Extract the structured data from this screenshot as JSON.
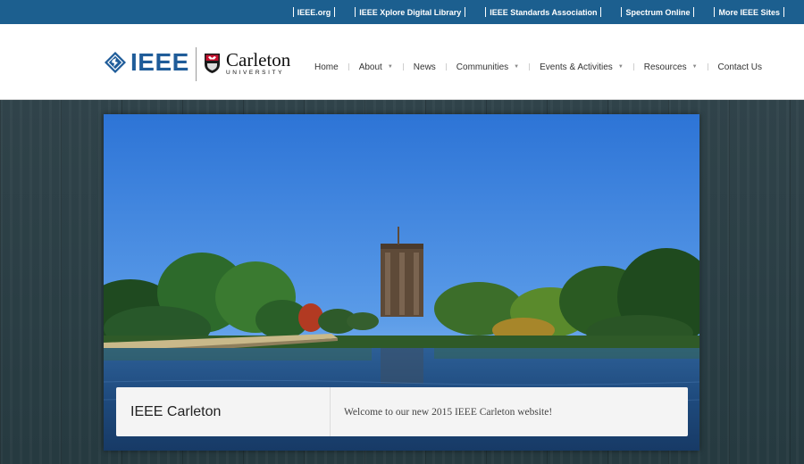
{
  "top_links": [
    {
      "label": "IEEE.org"
    },
    {
      "label": "IEEE Xplore Digital Library"
    },
    {
      "label": "IEEE Standards Association"
    },
    {
      "label": "Spectrum Online"
    },
    {
      "label": "More IEEE Sites"
    }
  ],
  "logos": {
    "ieee": "IEEE",
    "carleton_name": "Carleton",
    "carleton_sub": "UNIVERSITY"
  },
  "nav": [
    {
      "label": "Home",
      "has_dropdown": false
    },
    {
      "label": "About",
      "has_dropdown": true
    },
    {
      "label": "News",
      "has_dropdown": false
    },
    {
      "label": "Communities",
      "has_dropdown": true
    },
    {
      "label": "Events & Activities",
      "has_dropdown": true
    },
    {
      "label": "Resources",
      "has_dropdown": true
    },
    {
      "label": "Contact Us",
      "has_dropdown": false
    }
  ],
  "hero": {
    "caption_title": "IEEE Carleton",
    "caption_text": "Welcome to our new 2015 IEEE Carleton website!"
  },
  "colors": {
    "topbar": "#1c5f8f",
    "ieee_blue": "#1f5c99",
    "carleton_red": "#c8102e"
  }
}
